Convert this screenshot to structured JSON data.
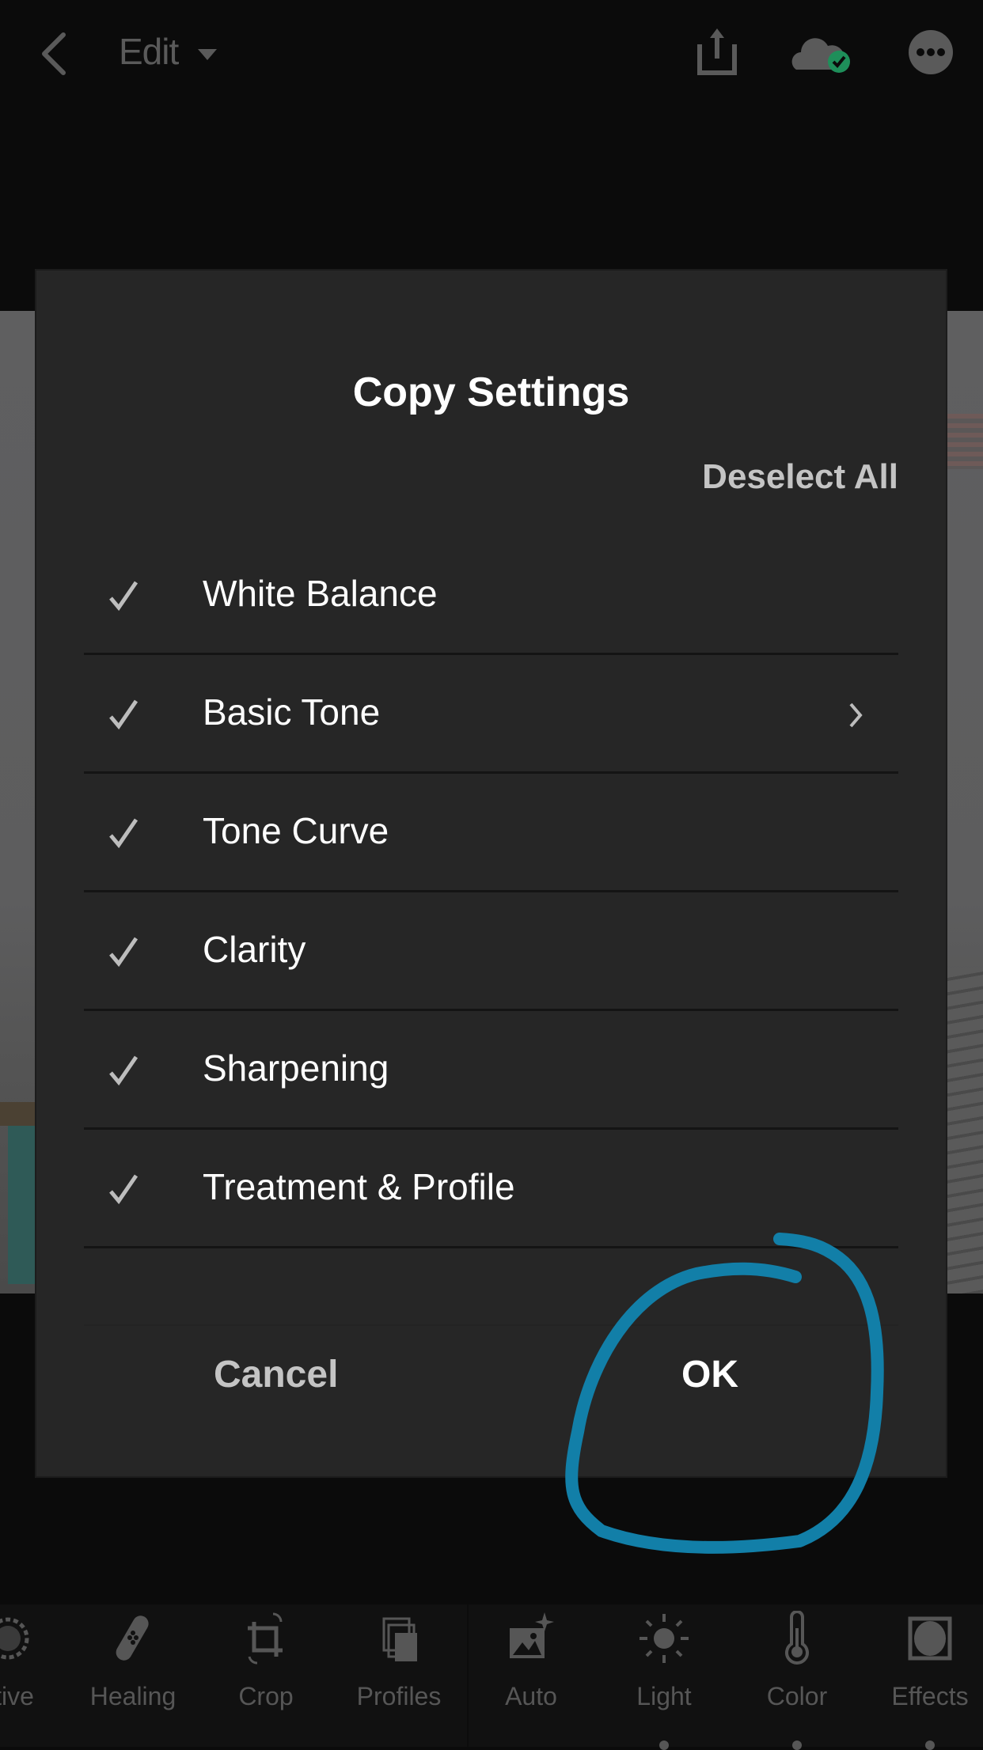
{
  "header": {
    "back_icon": "chevron-left-icon",
    "mode_label": "Edit",
    "mode_dropdown_icon": "caret-down-icon",
    "actions": [
      {
        "name": "share",
        "icon": "share-icon"
      },
      {
        "name": "cloud-sync",
        "icon": "cloud-synced-icon",
        "status_color": "#1e8f5a"
      },
      {
        "name": "more",
        "icon": "more-icon"
      }
    ]
  },
  "dialog": {
    "title": "Copy Settings",
    "deselect_all_label": "Deselect All",
    "items": [
      {
        "label": "White Balance",
        "checked": true,
        "has_submenu": false
      },
      {
        "label": "Basic Tone",
        "checked": true,
        "has_submenu": true
      },
      {
        "label": "Tone Curve",
        "checked": true,
        "has_submenu": false
      },
      {
        "label": "Clarity",
        "checked": true,
        "has_submenu": false
      },
      {
        "label": "Sharpening",
        "checked": true,
        "has_submenu": false
      },
      {
        "label": "Treatment & Profile",
        "checked": true,
        "has_submenu": false
      }
    ],
    "cancel_label": "Cancel",
    "ok_label": "OK"
  },
  "annotation": {
    "type": "hand-drawn circle around OK",
    "color": "#127fa8"
  },
  "toolbar": {
    "tools": [
      {
        "label": "ctive",
        "icon": "selective-icon",
        "has_dot": false
      },
      {
        "label": "Healing",
        "icon": "bandage-icon",
        "has_dot": false
      },
      {
        "label": "Crop",
        "icon": "crop-icon",
        "has_dot": false
      },
      {
        "label": "Profiles",
        "icon": "profiles-icon",
        "has_dot": false
      },
      {
        "label": "Auto",
        "icon": "auto-icon",
        "has_dot": false
      },
      {
        "label": "Light",
        "icon": "sun-icon",
        "has_dot": true
      },
      {
        "label": "Color",
        "icon": "thermometer-icon",
        "has_dot": true
      },
      {
        "label": "Effects",
        "icon": "effects-icon",
        "has_dot": true
      }
    ]
  }
}
